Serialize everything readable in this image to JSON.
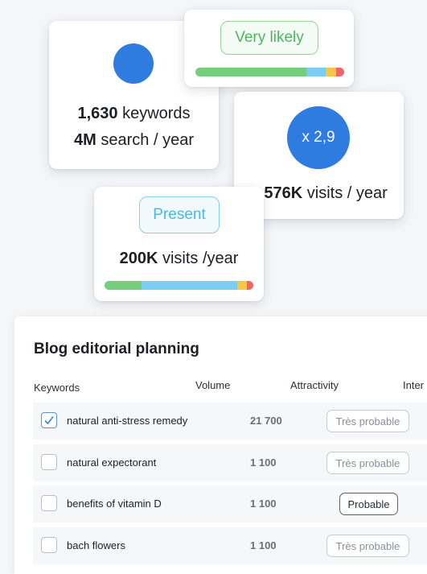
{
  "cards": {
    "keywords": {
      "line1_number": "1,630",
      "line1_text": " keywords",
      "line2_number": "4M",
      "line2_text": " search / year"
    },
    "very_likely": {
      "label": "Very likely",
      "distribution": [
        {
          "name": "green",
          "value": 0.745,
          "color": "#74cf7c"
        },
        {
          "name": "blue",
          "value": 0.13,
          "color": "#7ccdf4"
        },
        {
          "name": "yellow",
          "value": 0.07,
          "color": "#f7c547"
        },
        {
          "name": "red",
          "value": 0.055,
          "color": "#f0656a"
        }
      ]
    },
    "visits": {
      "multiplier": "x 2,9",
      "line_number": "+ 576K",
      "line_text": " visits / year"
    },
    "present": {
      "label": "Present",
      "line_number": "200K",
      "line_text": " visits /year",
      "distribution": [
        {
          "name": "green",
          "value": 0.25,
          "color": "#74cf7c"
        },
        {
          "name": "blue",
          "value": 0.64,
          "color": "#7ccdf4"
        },
        {
          "name": "yellow",
          "value": 0.065,
          "color": "#f7c547"
        },
        {
          "name": "red",
          "value": 0.045,
          "color": "#f0656a"
        }
      ]
    }
  },
  "table": {
    "title": "Blog editorial planning",
    "headers": {
      "keywords": "Keywords",
      "volume": "Volume",
      "attractivity": "Attractivity",
      "intent": "Inter"
    },
    "rows": [
      {
        "keyword": "natural anti-stress remedy",
        "volume": "21 700",
        "attractivity": "Très probable",
        "checked": true
      },
      {
        "keyword": "natural expectorant",
        "volume": "1 100",
        "attractivity": "Très probable",
        "checked": false
      },
      {
        "keyword": "benefits of vitamin D",
        "volume": "1 100",
        "attractivity": "Probable",
        "checked": false
      },
      {
        "keyword": "bach flowers",
        "volume": "1 100",
        "attractivity": "Très probable",
        "checked": false
      }
    ]
  }
}
